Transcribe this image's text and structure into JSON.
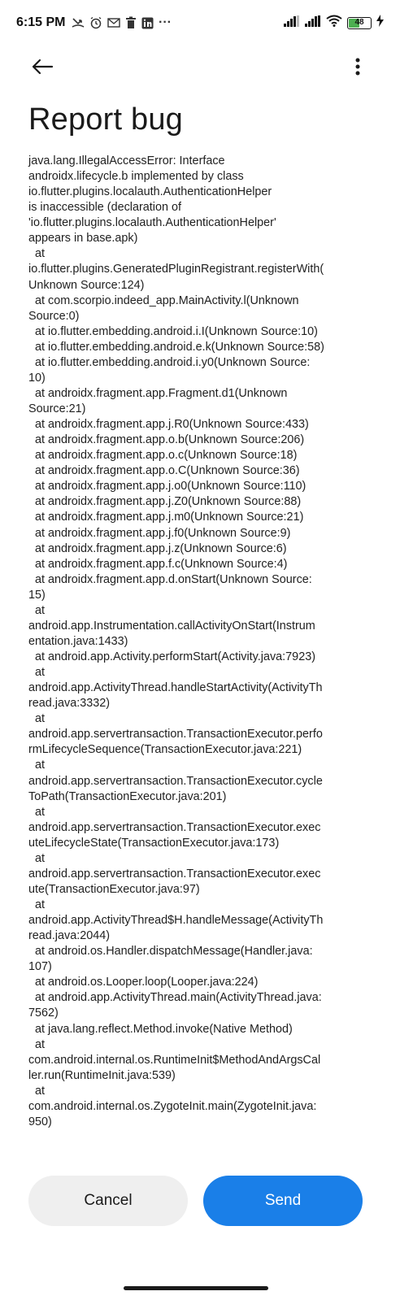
{
  "status_bar": {
    "time": "6:15 PM",
    "dots": "···",
    "battery_level": "48",
    "icons_left": [
      "missed-call-icon",
      "alarm-icon",
      "gmail-icon",
      "delete-icon",
      "linkedin-icon",
      "more-dots-icon"
    ],
    "icons_right": [
      "signal-icon",
      "signal-icon",
      "wifi-icon",
      "battery-icon",
      "charging-icon"
    ]
  },
  "header": {
    "back_icon": "arrow-left-icon",
    "menu_icon": "more-vert-icon"
  },
  "page": {
    "title": "Report bug",
    "report_text": "java.lang.IllegalAccessError: Interface\nandroidx.lifecycle.b implemented by class\nio.flutter.plugins.localauth.AuthenticationHelper\nis inaccessible (declaration of\n'io.flutter.plugins.localauth.AuthenticationHelper'\nappears in base.apk)\n  at\nio.flutter.plugins.GeneratedPluginRegistrant.registerWith(\nUnknown Source:124)\n  at com.scorpio.indeed_app.MainActivity.l(Unknown\nSource:0)\n  at io.flutter.embedding.android.i.I(Unknown Source:10)\n  at io.flutter.embedding.android.e.k(Unknown Source:58)\n  at io.flutter.embedding.android.i.y0(Unknown Source:\n10)\n  at androidx.fragment.app.Fragment.d1(Unknown\nSource:21)\n  at androidx.fragment.app.j.R0(Unknown Source:433)\n  at androidx.fragment.app.o.b(Unknown Source:206)\n  at androidx.fragment.app.o.c(Unknown Source:18)\n  at androidx.fragment.app.o.C(Unknown Source:36)\n  at androidx.fragment.app.j.o0(Unknown Source:110)\n  at androidx.fragment.app.j.Z0(Unknown Source:88)\n  at androidx.fragment.app.j.m0(Unknown Source:21)\n  at androidx.fragment.app.j.f0(Unknown Source:9)\n  at androidx.fragment.app.j.z(Unknown Source:6)\n  at androidx.fragment.app.f.c(Unknown Source:4)\n  at androidx.fragment.app.d.onStart(Unknown Source:\n15)\n  at\nandroid.app.Instrumentation.callActivityOnStart(Instrum\nentation.java:1433)\n  at android.app.Activity.performStart(Activity.java:7923)\n  at\nandroid.app.ActivityThread.handleStartActivity(ActivityTh\nread.java:3332)\n  at\nandroid.app.servertransaction.TransactionExecutor.perfo\nrmLifecycleSequence(TransactionExecutor.java:221)\n  at\nandroid.app.servertransaction.TransactionExecutor.cycle\nToPath(TransactionExecutor.java:201)\n  at\nandroid.app.servertransaction.TransactionExecutor.exec\nuteLifecycleState(TransactionExecutor.java:173)\n  at\nandroid.app.servertransaction.TransactionExecutor.exec\nute(TransactionExecutor.java:97)\n  at\nandroid.app.ActivityThread$H.handleMessage(ActivityTh\nread.java:2044)\n  at android.os.Handler.dispatchMessage(Handler.java:\n107)\n  at android.os.Looper.loop(Looper.java:224)\n  at android.app.ActivityThread.main(ActivityThread.java:\n7562)\n  at java.lang.reflect.Method.invoke(Native Method)\n  at\ncom.android.internal.os.RuntimeInit$MethodAndArgsCal\nler.run(RuntimeInit.java:539)\n  at\ncom.android.internal.os.ZygoteInit.main(ZygoteInit.java:\n950)"
  },
  "actions": {
    "cancel_label": "Cancel",
    "send_label": "Send"
  },
  "colors": {
    "send_button": "#1a7fe8",
    "cancel_button": "#efefef",
    "battery_fill": "#4caf50"
  }
}
